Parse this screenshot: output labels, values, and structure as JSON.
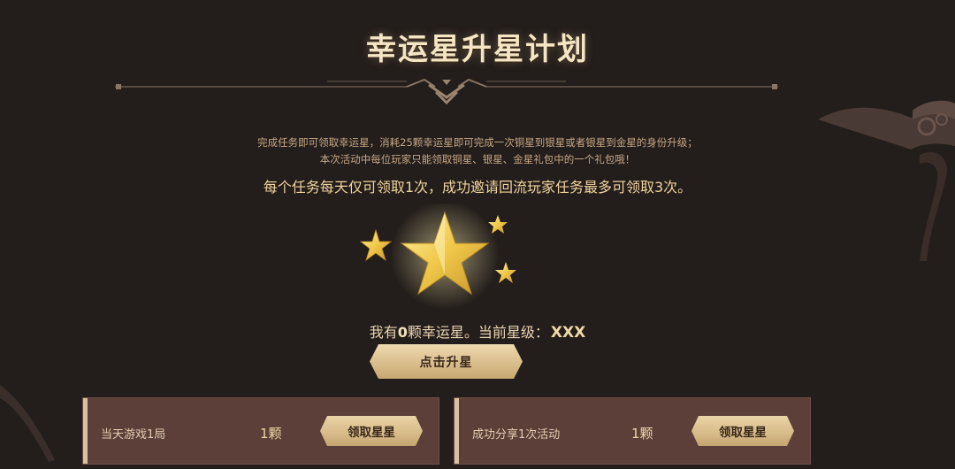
{
  "header": {
    "title": "幸运星升星计划"
  },
  "description": {
    "line1": "完成任务即可领取幸运星，消耗25颗幸运星即可完成一次铜星到银星或者银星到金星的身份升级；",
    "line2": "本次活动中每位玩家只能领取铜星、银星、金星礼包中的一个礼包哦！",
    "notice": "每个任务每天仅可领取1次，成功邀请回流玩家任务最多可领取3次。"
  },
  "status": {
    "prefix": "我有",
    "count": "0",
    "suffix": "颗幸运星。当前星级：",
    "level": "XXX"
  },
  "upgrade_button": {
    "label": "点击升星"
  },
  "tasks": [
    {
      "name": "当天游戏1局",
      "reward": "1颗",
      "button": "领取星星"
    },
    {
      "name": "成功分享1次活动",
      "reward": "1颗",
      "button": "领取星星"
    }
  ],
  "colors": {
    "background": "#231d1b",
    "accent_gold": "#f0d49d",
    "card": "#5b3f38"
  },
  "icons": [
    "star-icon",
    "divider-ornament-icon",
    "cloud-ornament-icon"
  ]
}
